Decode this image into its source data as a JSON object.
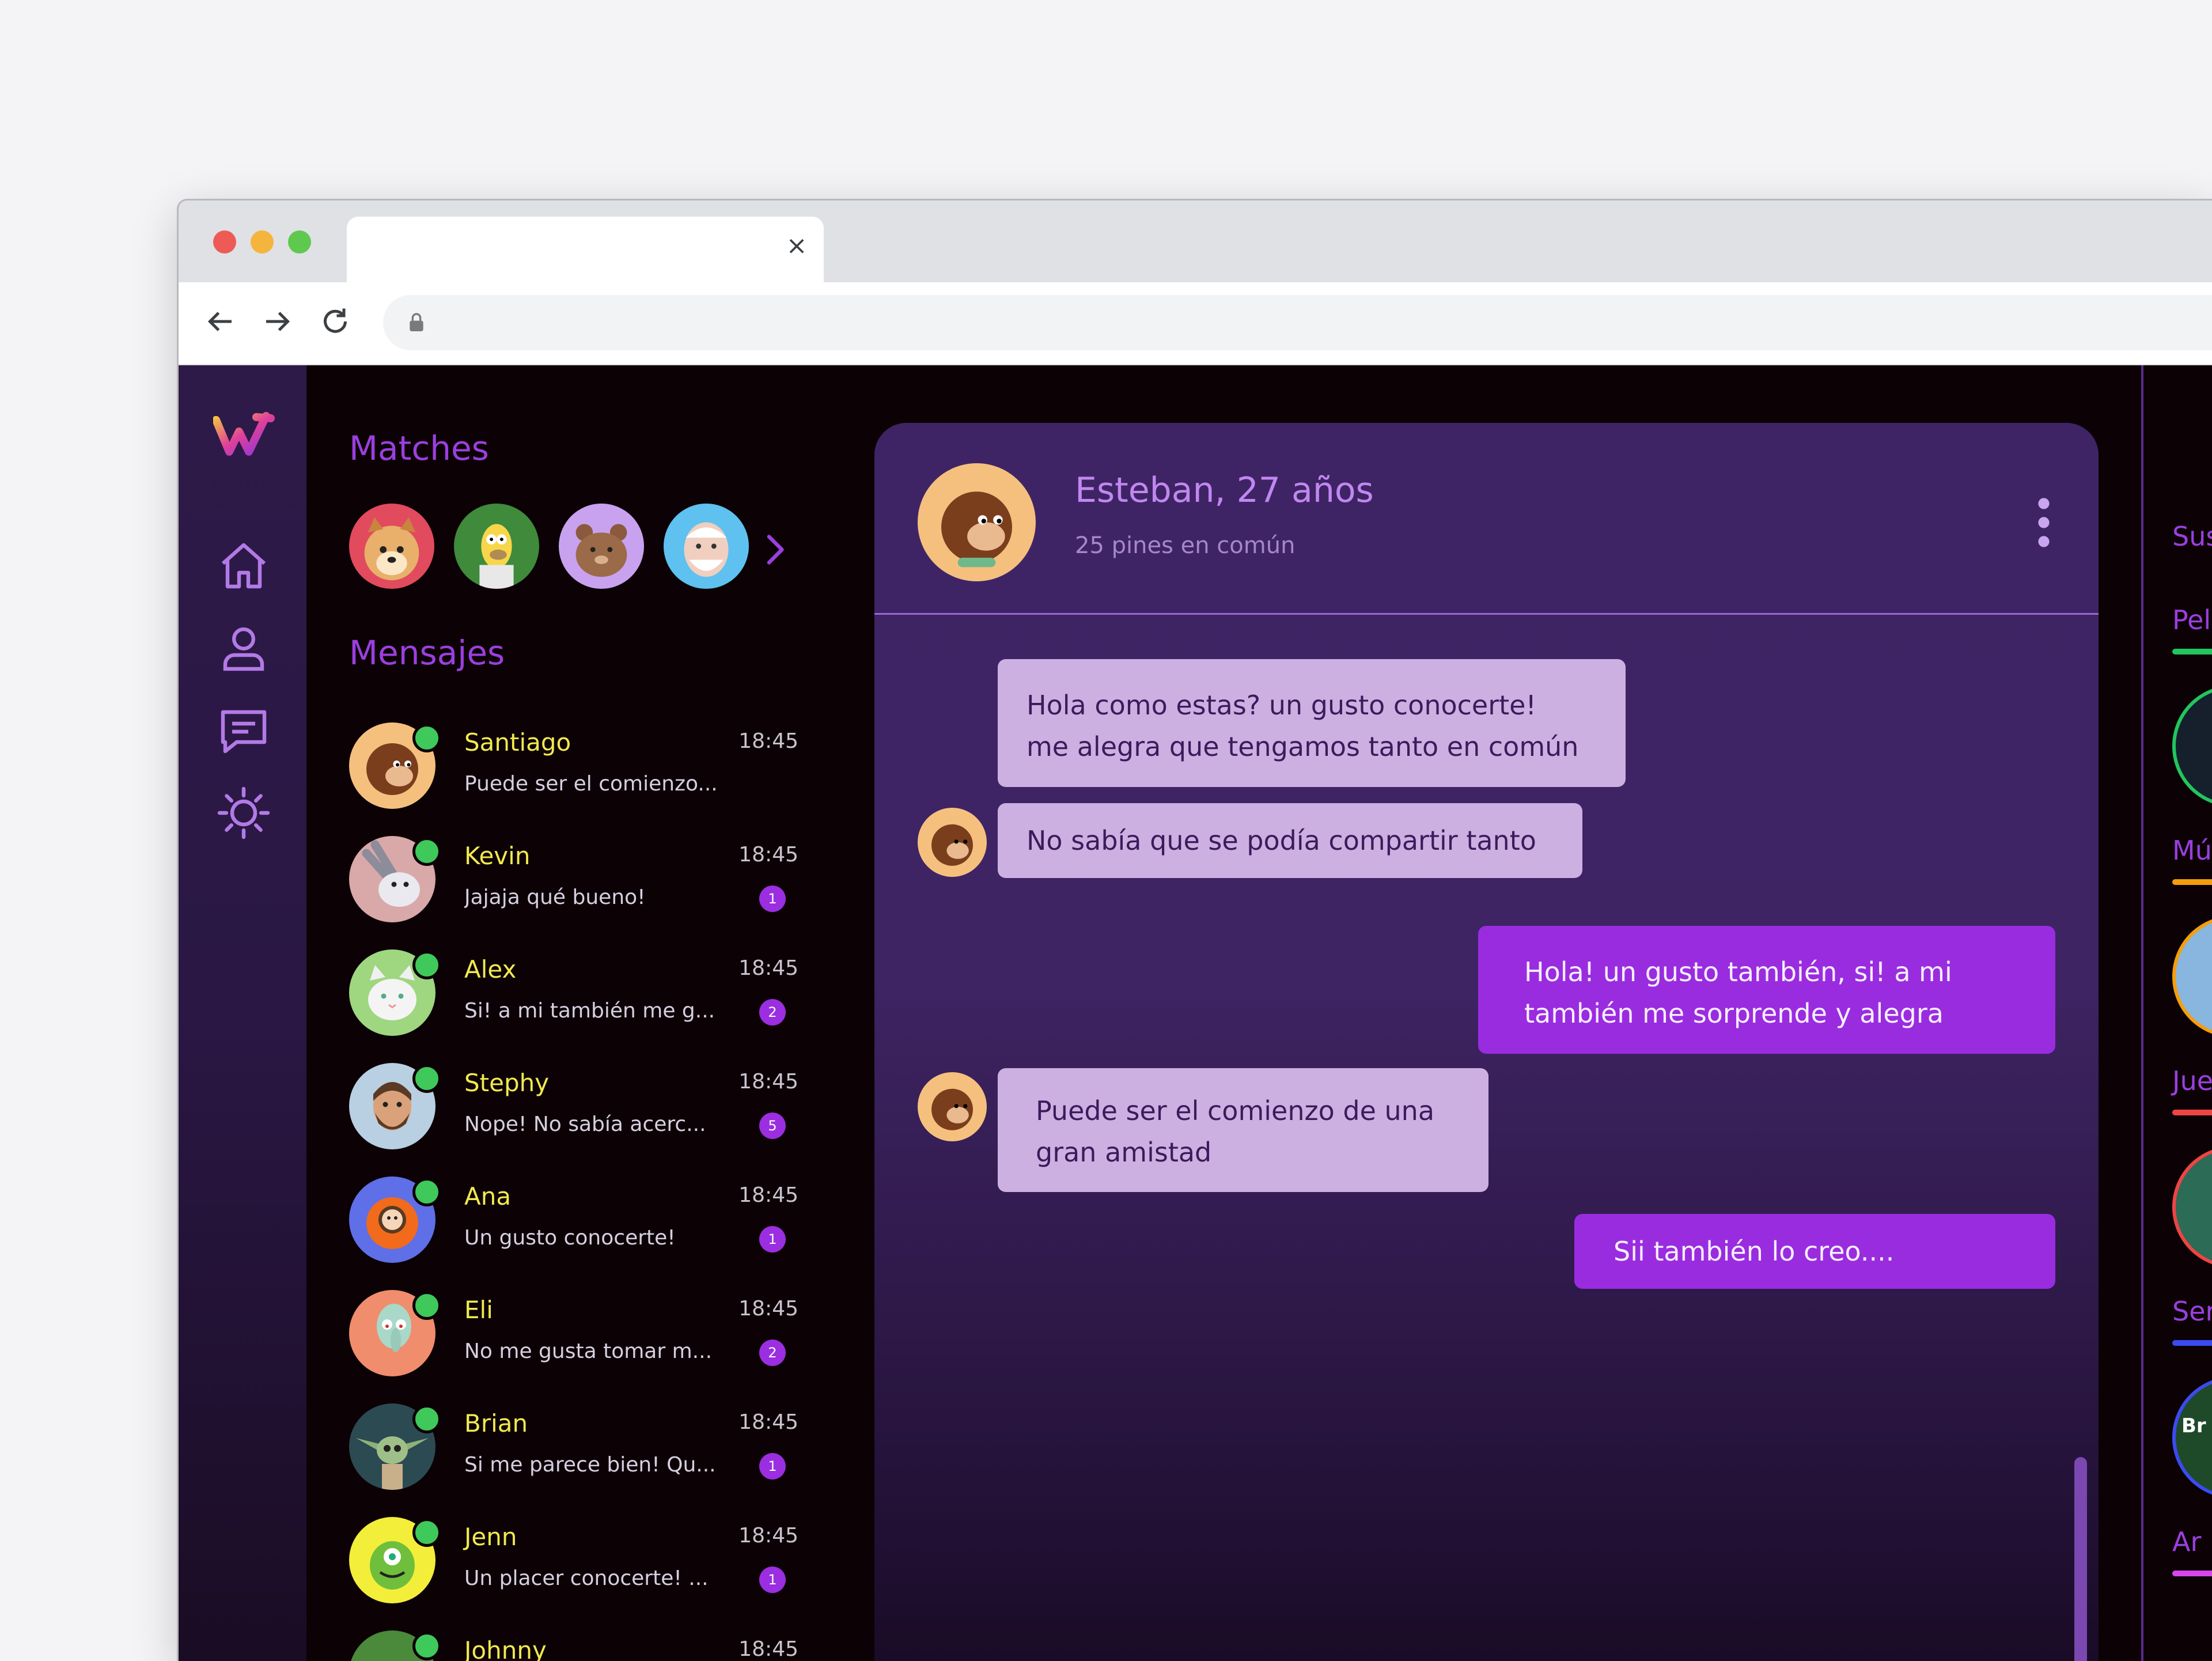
{
  "app": {
    "sidebar": {
      "logo": "app-logo",
      "items": [
        "home-icon",
        "profile-icon",
        "messages-icon",
        "brightness-icon"
      ]
    },
    "matches_title": "Matches",
    "messages_title": "Mensajes",
    "matches": [
      "doge",
      "homer",
      "bear",
      "old-man"
    ],
    "conversations": [
      {
        "name": "Santiago",
        "time": "18:45",
        "preview": "Puede ser el comienzo...",
        "badge": ""
      },
      {
        "name": "Kevin",
        "time": "18:45",
        "preview": "Jajaja qué bueno!",
        "badge": "1"
      },
      {
        "name": "Alex",
        "time": "18:45",
        "preview": "Si! a mi también me g...",
        "badge": "2"
      },
      {
        "name": "Stephy",
        "time": "18:45",
        "preview": "Nope! No sabía acerc...",
        "badge": "5"
      },
      {
        "name": "Ana",
        "time": "18:45",
        "preview": "Un gusto conocerte!",
        "badge": "1"
      },
      {
        "name": "Eli",
        "time": "18:45",
        "preview": "No me gusta tomar m...",
        "badge": "2"
      },
      {
        "name": "Brian",
        "time": "18:45",
        "preview": "Si me parece bien! Qu...",
        "badge": "1"
      },
      {
        "name": "Jenn",
        "time": "18:45",
        "preview": "Un placer conocerte! ...",
        "badge": "1"
      },
      {
        "name": "Johnny",
        "time": "18:45",
        "preview": "",
        "badge": ""
      }
    ],
    "chat": {
      "name": "Esteban, 27 años",
      "subtitle": "25 pines en común",
      "messages": [
        {
          "dir": "in",
          "text": "Hola como estas? un gusto conocerte!\nme alegra que tengamos tanto en común"
        },
        {
          "dir": "in",
          "text": "No sabía que se podía compartir tanto"
        },
        {
          "dir": "out",
          "text": "Hola! un gusto también, si! a mi\ntambién me sorprende y alegra"
        },
        {
          "dir": "in",
          "text": "Puede ser el comienzo de una\ngran amistad"
        },
        {
          "dir": "out",
          "text": "Sii también lo creo...."
        }
      ]
    },
    "right_panel": {
      "sections": [
        {
          "label": "Sus",
          "color": "#9b3fe0"
        },
        {
          "label": "Pel",
          "color": "#22c55e"
        },
        {
          "label": "Mú",
          "color": "#f59e0b"
        },
        {
          "label": "Jue",
          "color": "#ef4444"
        },
        {
          "label": "Ser",
          "color": "#3b4bf0"
        },
        {
          "label": "Ar",
          "color": "#d946ef"
        }
      ],
      "tile_text": "Br"
    },
    "colors": {
      "accent": "#9b2ee0",
      "name_yellow": "#f2e94e",
      "online": "#3fc95a",
      "bubble_in": "#cdb0e2",
      "bubble_out": "#9a2ce0"
    }
  }
}
